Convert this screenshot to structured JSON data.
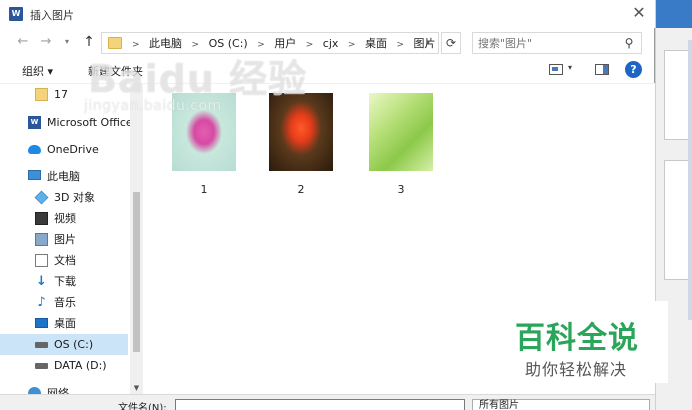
{
  "dialog": {
    "title": "插入图片",
    "title_icon": "word-icon",
    "close_glyph": "✕"
  },
  "address": {
    "crumbs": [
      "此电脑",
      "OS (C:)",
      "用户",
      "cjx",
      "桌面",
      "图片"
    ]
  },
  "search": {
    "placeholder": "搜索\"图片\""
  },
  "toolbar": {
    "organize_label": "组织 ▾",
    "new_folder_label": "新建文件夹",
    "help_glyph": "?"
  },
  "nav": {
    "items": [
      {
        "label": "17",
        "icon": "folder-icon"
      },
      {
        "label": "Microsoft Office",
        "icon": "word-icon"
      },
      {
        "label": "OneDrive",
        "icon": "cloud-icon"
      },
      {
        "label": "此电脑",
        "icon": "computer-icon"
      },
      {
        "label": "3D 对象",
        "icon": "3d-objects-icon"
      },
      {
        "label": "视频",
        "icon": "video-icon"
      },
      {
        "label": "图片",
        "icon": "pictures-icon"
      },
      {
        "label": "文档",
        "icon": "documents-icon"
      },
      {
        "label": "下载",
        "icon": "download-icon"
      },
      {
        "label": "音乐",
        "icon": "music-icon"
      },
      {
        "label": "桌面",
        "icon": "desktop-icon"
      },
      {
        "label": "OS (C:)",
        "icon": "drive-icon",
        "selected": true
      },
      {
        "label": "DATA (D:)",
        "icon": "drive-icon"
      },
      {
        "label": "网络",
        "icon": "network-icon"
      }
    ]
  },
  "files": [
    {
      "name": "1",
      "thumb": "pink-flower-thumbnail"
    },
    {
      "name": "2",
      "thumb": "red-tulip-thumbnail"
    },
    {
      "name": "3",
      "thumb": "green-leaf-thumbnail"
    }
  ],
  "bottom": {
    "filename_label": "文件名(N):",
    "filename_value": "",
    "filetype_value": "所有图片"
  },
  "watermark": {
    "baidu": "Baidu 经验",
    "jingyan_url": "jingyan.baidu.com",
    "brand_big": "百科全说",
    "brand_small": "助你轻松解决"
  }
}
